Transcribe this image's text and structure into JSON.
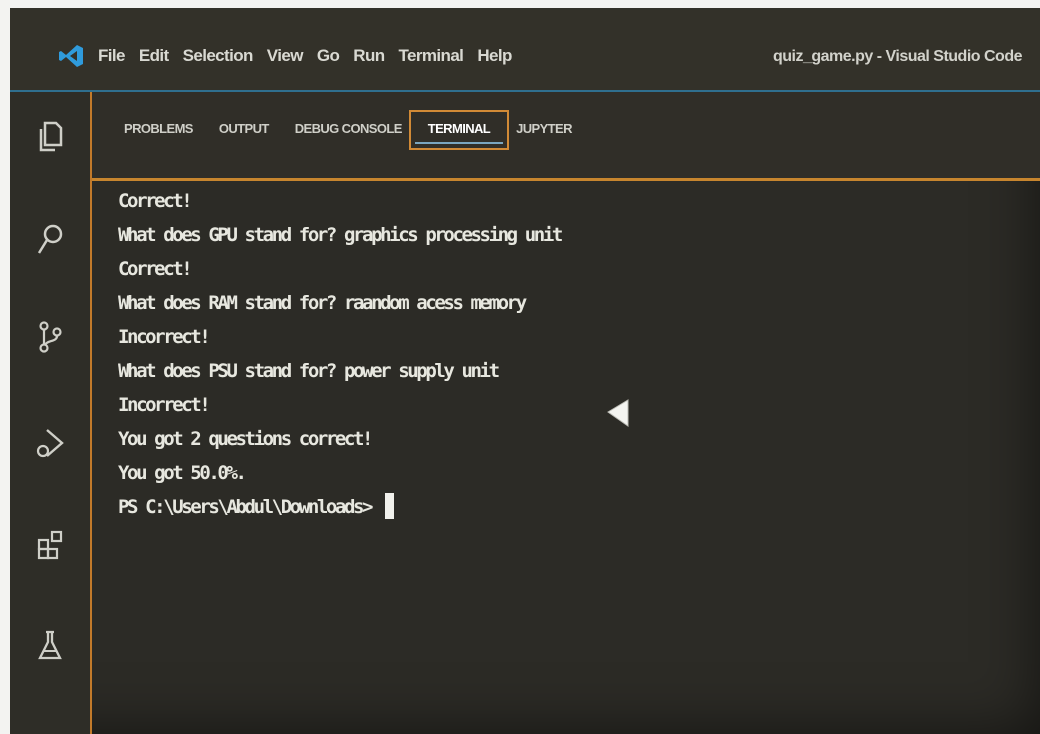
{
  "window": {
    "title": "quiz_game.py - Visual Studio Code"
  },
  "menu": {
    "items": [
      "File",
      "Edit",
      "Selection",
      "View",
      "Go",
      "Run",
      "Terminal",
      "Help"
    ]
  },
  "activity_bar": {
    "icons": [
      "files-icon",
      "search-icon",
      "source-control-icon",
      "run-debug-icon",
      "extensions-icon",
      "testing-icon"
    ]
  },
  "panel": {
    "tabs": [
      "PROBLEMS",
      "OUTPUT",
      "DEBUG CONSOLE",
      "TERMINAL",
      "JUPYTER"
    ],
    "active_tab": "TERMINAL"
  },
  "terminal": {
    "lines": [
      "Correct!",
      "What does GPU stand for? graphics processing unit",
      "Correct!",
      "What does RAM stand for? raandom acess memory",
      "Incorrect!",
      "What does PSU stand for? power supply unit",
      "Incorrect!",
      "You got 2 questions correct!",
      "You got 50.0%."
    ],
    "prompt": "PS C:\\Users\\Abdul\\Downloads>"
  },
  "colors": {
    "background": "#2c2b26",
    "accent": "#c7852e",
    "text": "#e7e7df",
    "logo": "#2f9bdc"
  }
}
